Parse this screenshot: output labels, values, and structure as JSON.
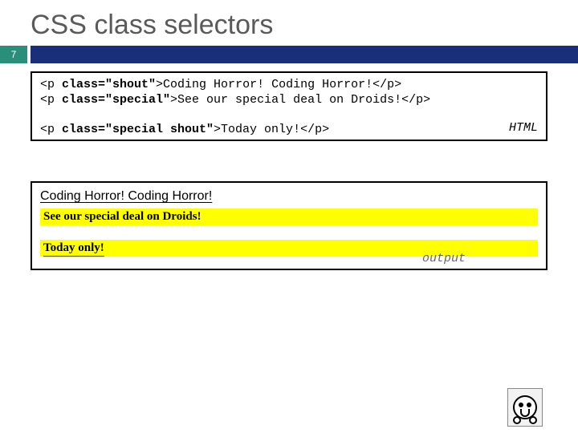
{
  "title": "CSS class selectors",
  "page_number": "7",
  "code": {
    "l1a": "<p ",
    "l1b": "class=\"shout\"",
    "l1c": ">Coding Horror! Coding Horror!</p>",
    "l2a": "<p ",
    "l2b": "class=\"special\"",
    "l2c": ">See our special deal on Droids!</p>",
    "l3a": "<p ",
    "l3b": "class=\"special shout\"",
    "l3c": ">Today only!</p>",
    "lang": "HTML"
  },
  "output": {
    "line1": "Coding Horror! Coding Horror!",
    "line2": "See our special deal on Droids!",
    "line3": "Today only!",
    "label": "output"
  }
}
